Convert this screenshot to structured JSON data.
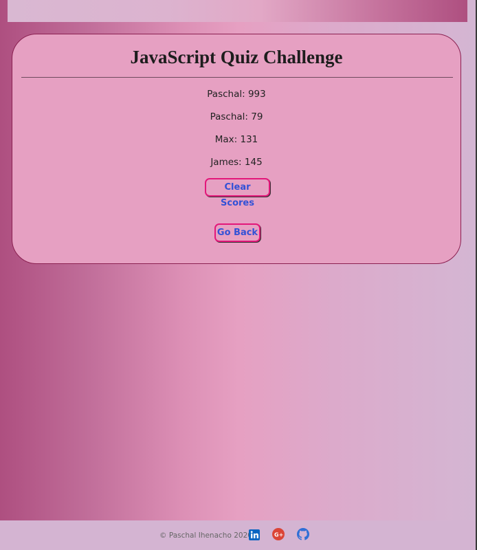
{
  "quiz": {
    "title": "JavaScript Quiz Challenge",
    "scores": [
      {
        "text": "Paschal: 993"
      },
      {
        "text": "Paschal: 79"
      },
      {
        "text": "Max: 131"
      },
      {
        "text": "James: 145"
      }
    ],
    "clear_label": "Clear Scores",
    "back_label": "Go Back"
  },
  "footer": {
    "copyright": "© Paschal Ihenacho 2020",
    "icons": [
      "linkedin-icon",
      "google-plus-icon",
      "github-icon"
    ]
  },
  "colors": {
    "card_bg": "#e6a0c2",
    "card_border": "#8a1f50",
    "button_border": "#e3177a",
    "button_text": "#3251d6",
    "linkedin": "#0a66c2",
    "google_plus": "#db4437",
    "github": "#2f6fd6"
  }
}
